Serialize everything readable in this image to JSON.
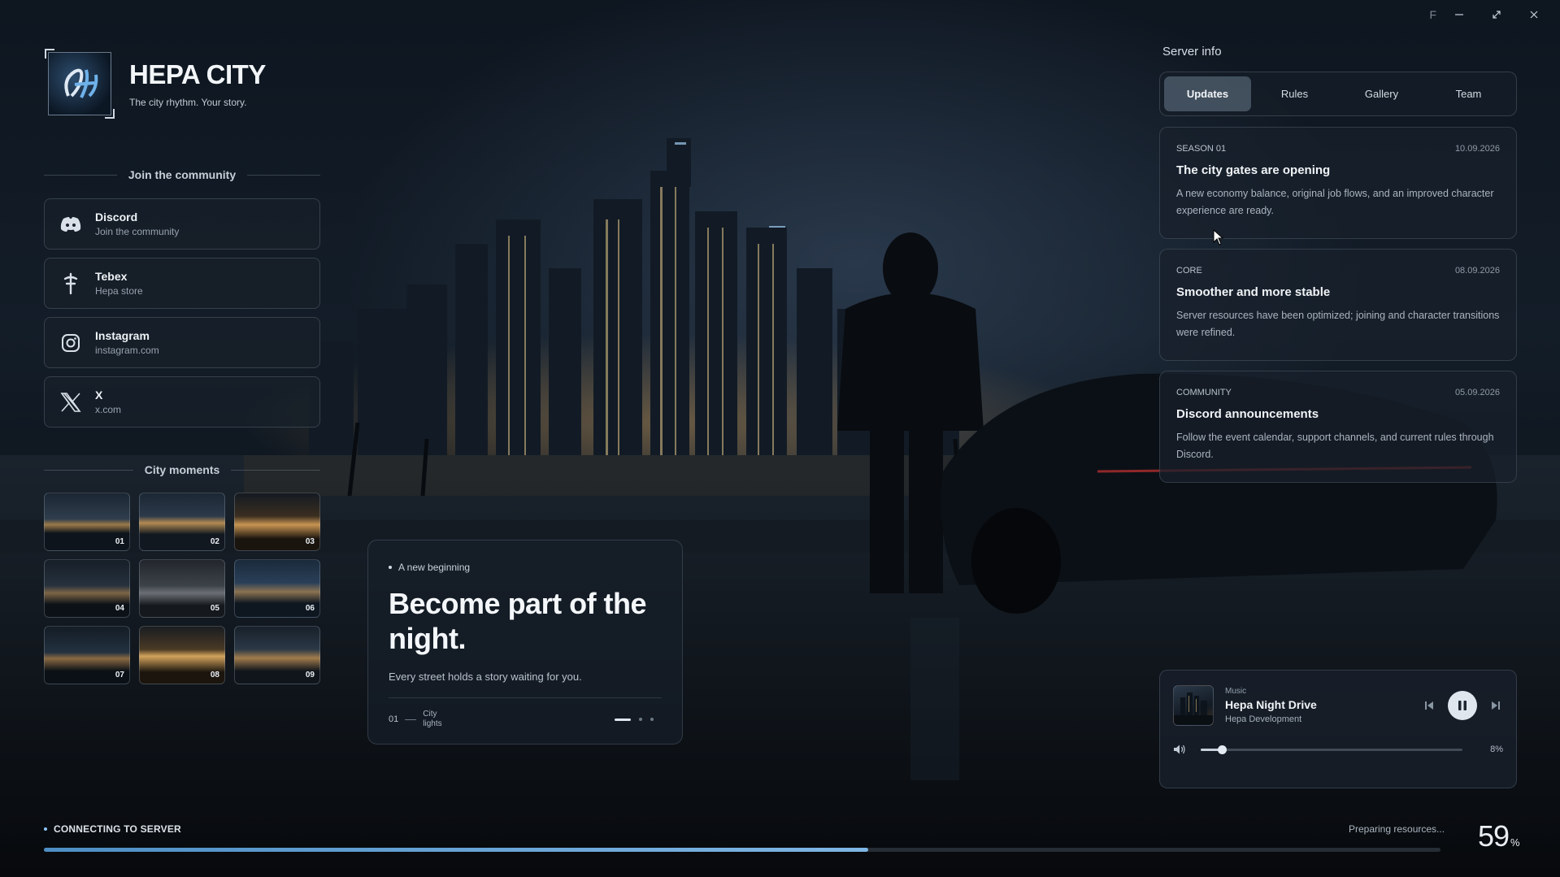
{
  "window": {
    "letter": "F",
    "minimize_icon": "minimize-icon",
    "maximize_icon": "maximize-icon",
    "close_icon": "close-icon"
  },
  "brand": {
    "title": "HEPA CITY",
    "tagline": "The city rhythm. Your story."
  },
  "community": {
    "heading": "Join the community",
    "links": [
      {
        "name": "Discord",
        "sub": "Join the community",
        "icon": "discord-icon"
      },
      {
        "name": "Tebex",
        "sub": "Hepa store",
        "icon": "tebex-icon"
      },
      {
        "name": "Instagram",
        "sub": "instagram.com",
        "icon": "instagram-icon"
      },
      {
        "name": "X",
        "sub": "x.com",
        "icon": "x-icon"
      }
    ]
  },
  "moments": {
    "heading": "City moments",
    "items": [
      "01",
      "02",
      "03",
      "04",
      "05",
      "06",
      "07",
      "08",
      "09"
    ]
  },
  "hero": {
    "kicker": "A new beginning",
    "title": "Become part of the night.",
    "description": "Every street holds a story waiting for you.",
    "index": "01",
    "caption": "City lights",
    "slides": 3,
    "active_slide": 1
  },
  "server": {
    "title": "Server info",
    "tabs": [
      "Updates",
      "Rules",
      "Gallery",
      "Team"
    ],
    "active_tab": "Updates",
    "updates": [
      {
        "tag": "SEASON 01",
        "date": "10.09.2026",
        "title": "The city gates are opening",
        "body": "A new economy balance, original job flows, and an improved character experience are ready."
      },
      {
        "tag": "CORE",
        "date": "08.09.2026",
        "title": "Smoother and more stable",
        "body": "Server resources have been optimized; joining and character transitions were refined."
      },
      {
        "tag": "COMMUNITY",
        "date": "05.09.2026",
        "title": "Discord announcements",
        "body": "Follow the event calendar, support channels, and current rules through Discord."
      }
    ]
  },
  "music": {
    "label": "Music",
    "track": "Hepa Night Drive",
    "artist": "Hepa Development",
    "state": "playing",
    "volume_percent": 8,
    "volume_text": "8%"
  },
  "loading": {
    "status": "CONNECTING TO SERVER",
    "detail": "Preparing resources...",
    "progress_percent": 59,
    "progress_number": "59",
    "progress_unit": "%"
  },
  "colors": {
    "accent": "#7fb6e4",
    "panel": "#18202a",
    "text": "#e8edf3"
  }
}
